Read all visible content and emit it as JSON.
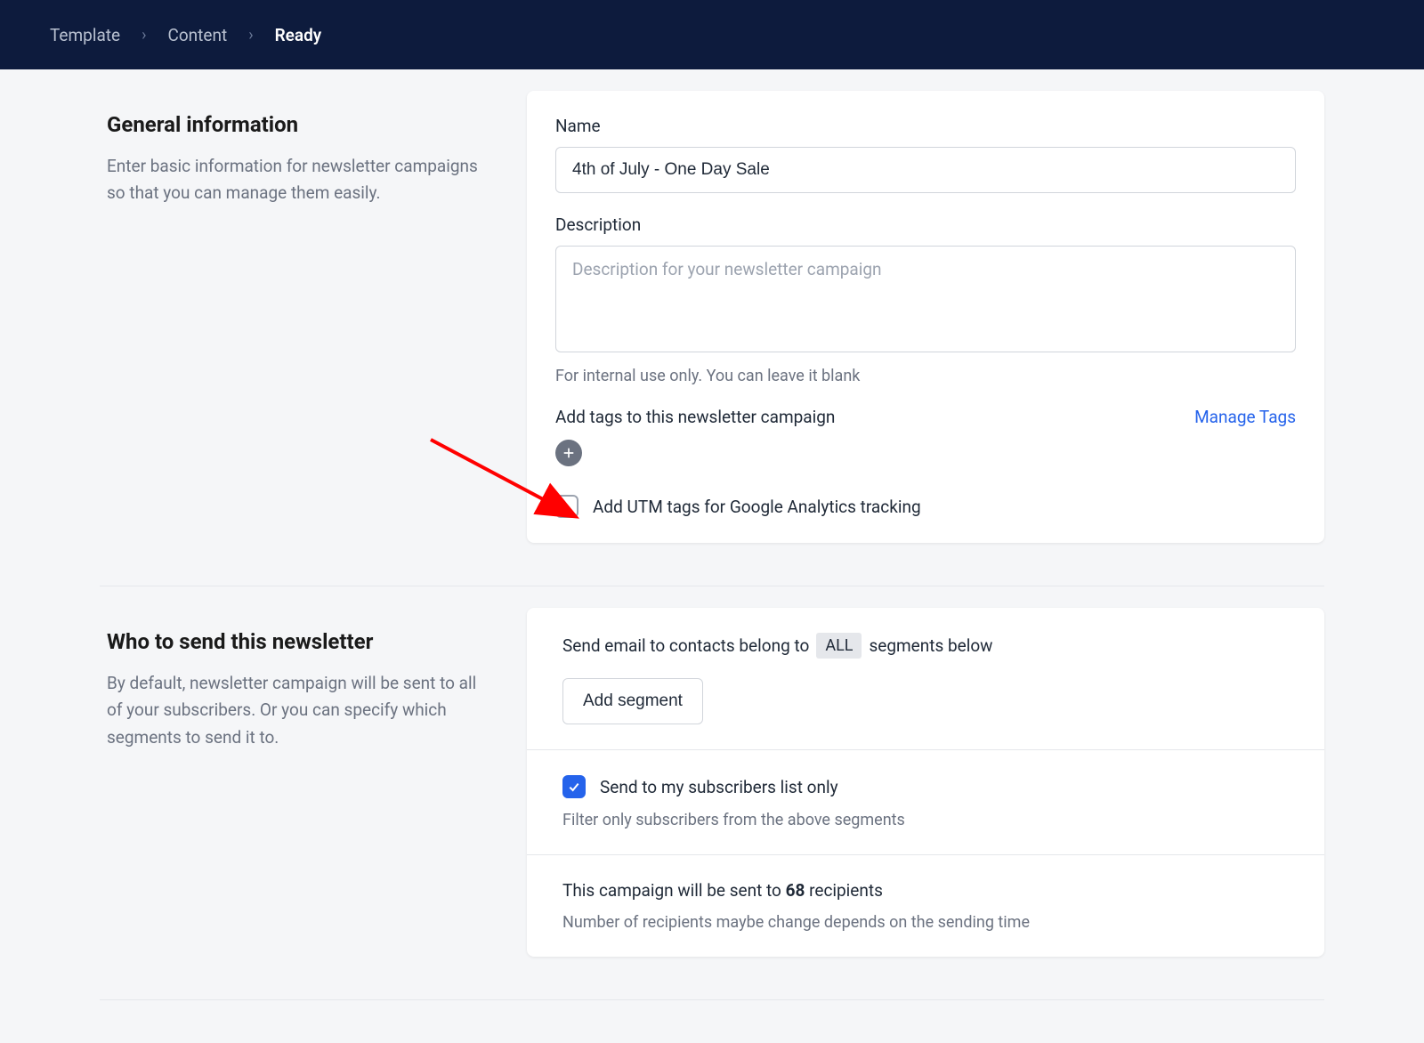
{
  "breadcrumb": {
    "items": [
      "Template",
      "Content",
      "Ready"
    ],
    "active_index": 2
  },
  "general": {
    "title": "General information",
    "description": "Enter basic information for newsletter campaigns so that you can manage them easily.",
    "name_label": "Name",
    "name_value": "4th of July - One Day Sale",
    "desc_label": "Description",
    "desc_placeholder": "Description for your newsletter campaign",
    "desc_hint": "For internal use only. You can leave it blank",
    "tags_label": "Add tags to this newsletter campaign",
    "manage_tags": "Manage Tags",
    "utm_checkbox_label": "Add UTM tags for Google Analytics tracking"
  },
  "audience": {
    "title": "Who to send this newsletter",
    "description": "By default, newsletter campaign will be sent to all of your subscribers. Or you can specify which segments to send it to.",
    "segment_prefix": "Send email to contacts belong to",
    "segment_badge": "ALL",
    "segment_suffix": "segments below",
    "add_segment_btn": "Add segment",
    "subscribers_only_label": "Send to my subscribers list only",
    "subscribers_hint": "Filter only subscribers from the above segments",
    "recipients_prefix": "This campaign will be sent to",
    "recipients_count": "68",
    "recipients_suffix": "recipients",
    "recipients_hint": "Number of recipients maybe change depends on the sending time"
  }
}
